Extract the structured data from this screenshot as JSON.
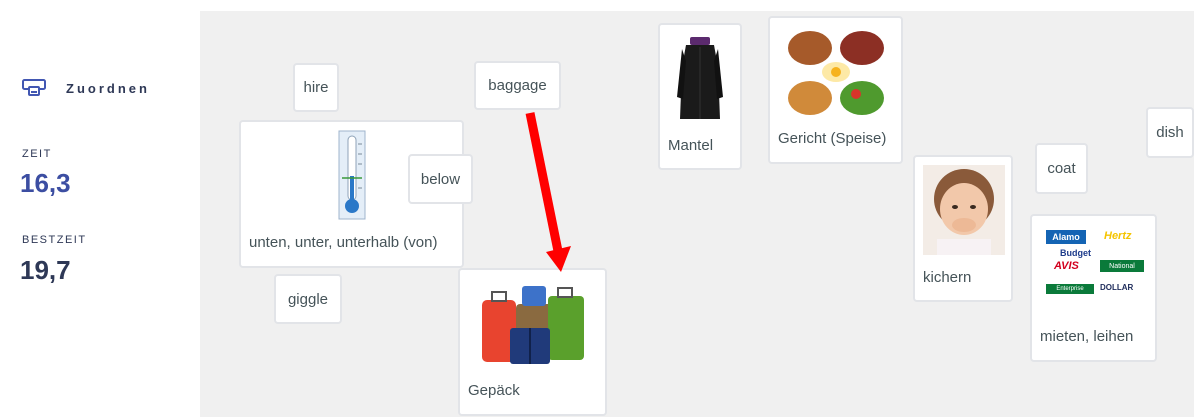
{
  "sidebar": {
    "mode_label": "Zuordnen",
    "mode_icon": "match-cards-icon",
    "time_label": "ZEIT",
    "time_value": "16,3",
    "best_label": "BESTZEIT",
    "best_value": "19,7"
  },
  "cards": {
    "hire": "hire",
    "baggage": "baggage",
    "below": "below",
    "giggle": "giggle",
    "dish": "dish",
    "coat": "coat",
    "unten": "unten, unter, unterhalb (von)",
    "gepaeck": "Gepäck",
    "mantel": "Mantel",
    "gericht": "Gericht (Speise)",
    "kichern": "kichern",
    "mieten": "mieten, leihen"
  },
  "images": {
    "thermometer": "thermometer-image",
    "luggage": "luggage-image",
    "coat": "black-coat-image",
    "food": "food-plates-image",
    "baby": "giggling-baby-image",
    "rental_logos": "car-rental-logos-image"
  },
  "logos": {
    "alamo": "Alamo",
    "hertz": "Hertz",
    "budget": "Budget",
    "avis": "AVIS",
    "national": "National",
    "enterprise": "Enterprise",
    "dollar": "DOLLAR"
  },
  "colors": {
    "accent": "#3c4ea2",
    "arrow": "#ff0000",
    "board": "#f0f0f0"
  }
}
